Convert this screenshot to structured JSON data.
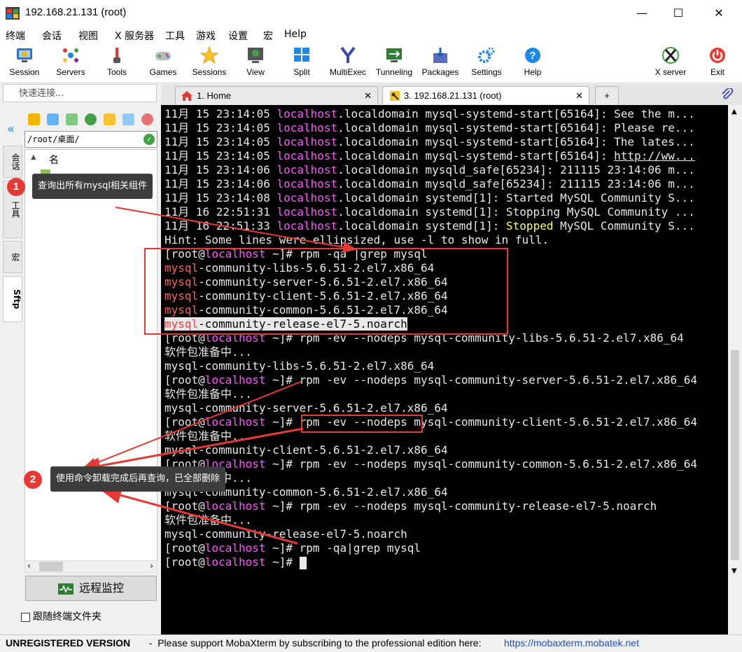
{
  "window": {
    "title": "192.168.21.131 (root)",
    "minimize": "—",
    "maximize": "☐",
    "close": "✕"
  },
  "menu": [
    "终端",
    "会话",
    "视图",
    "X 服务器",
    "工具",
    "游戏",
    "设置",
    "宏",
    "Help"
  ],
  "toolbar": [
    {
      "label": "Session",
      "icon": "session-icon"
    },
    {
      "label": "Servers",
      "icon": "servers-icon"
    },
    {
      "label": "Tools",
      "icon": "tools-icon"
    },
    {
      "label": "Games",
      "icon": "games-icon"
    },
    {
      "label": "Sessions",
      "icon": "sessions-star-icon"
    },
    {
      "label": "View",
      "icon": "view-icon"
    },
    {
      "label": "Split",
      "icon": "split-icon"
    },
    {
      "label": "MultiExec",
      "icon": "multiexec-icon"
    },
    {
      "label": "Tunneling",
      "icon": "tunneling-icon"
    },
    {
      "label": "Packages",
      "icon": "packages-icon"
    },
    {
      "label": "Settings",
      "icon": "settings-icon"
    },
    {
      "label": "Help",
      "icon": "help-icon"
    },
    {
      "label": "X server",
      "icon": "x-server-icon"
    },
    {
      "label": "Exit",
      "icon": "exit-icon"
    }
  ],
  "quick_connect_placeholder": "快速连接...",
  "tabs": [
    {
      "label": "1. Home"
    },
    {
      "label": "3. 192.168.21.131 (root)"
    }
  ],
  "side_tabs": [
    "会话",
    "工具",
    "宏",
    "Sftp"
  ],
  "sftp": {
    "path": "/root/桌面/",
    "column_name": "名",
    "monitor_button": "远程监控",
    "follow_label": "跟随终端文件夹"
  },
  "terminal_lines": [
    [
      {
        "t": "11月 15 23:14:05 "
      },
      {
        "t": "localhost",
        "c": "mag"
      },
      {
        "t": ".localdomain mysql-systemd-start[65164]: See the m..."
      }
    ],
    [
      {
        "t": "11月 15 23:14:05 "
      },
      {
        "t": "localhost",
        "c": "mag"
      },
      {
        "t": ".localdomain mysql-systemd-start[65164]: Please re..."
      }
    ],
    [
      {
        "t": "11月 15 23:14:05 "
      },
      {
        "t": "localhost",
        "c": "mag"
      },
      {
        "t": ".localdomain mysql-systemd-start[65164]: The lates..."
      }
    ],
    [
      {
        "t": "11月 15 23:14:05 "
      },
      {
        "t": "localhost",
        "c": "mag"
      },
      {
        "t": ".localdomain mysql-systemd-start[65164]: "
      },
      {
        "t": "http://ww...",
        "u": true
      }
    ],
    [
      {
        "t": "11月 15 23:14:06 "
      },
      {
        "t": "localhost",
        "c": "mag"
      },
      {
        "t": ".localdomain mysqld_safe[65234]: 211115 23:14:06 m..."
      }
    ],
    [
      {
        "t": "11月 15 23:14:06 "
      },
      {
        "t": "localhost",
        "c": "mag"
      },
      {
        "t": ".localdomain mysqld_safe[65234]: 211115 23:14:06 m..."
      }
    ],
    [
      {
        "t": "11月 15 23:14:08 "
      },
      {
        "t": "localhost",
        "c": "mag"
      },
      {
        "t": ".localdomain systemd[1]: Started MySQL Community S..."
      }
    ],
    [
      {
        "t": "11月 16 22:51:31 "
      },
      {
        "t": "localhost",
        "c": "mag"
      },
      {
        "t": ".localdomain systemd[1]: Stopping MySQL Community ..."
      }
    ],
    [
      {
        "t": "11月 16 22:51:33 "
      },
      {
        "t": "localhost",
        "c": "mag"
      },
      {
        "t": ".localdomain systemd[1]: "
      },
      {
        "t": "Stopped",
        "c": "yel"
      },
      {
        "t": " MySQL Community S..."
      }
    ],
    [
      {
        "t": "Hint: Some lines were ellipsized, use -l to show in full."
      }
    ],
    [
      {
        "t": "[root@"
      },
      {
        "t": "localhost",
        "c": "mag"
      },
      {
        "t": " ~]# rpm -qa |grep mysql"
      }
    ],
    [
      {
        "t": "mysql",
        "c": "red"
      },
      {
        "t": "-community-libs-5.6.51-2.el7.x86_64"
      }
    ],
    [
      {
        "t": "mysql",
        "c": "red"
      },
      {
        "t": "-community-server-5.6.51-2.el7.x86_64"
      }
    ],
    [
      {
        "t": "mysql",
        "c": "red"
      },
      {
        "t": "-community-client-5.6.51-2.el7.x86_64"
      }
    ],
    [
      {
        "t": "mysql",
        "c": "red"
      },
      {
        "t": "-community-common-5.6.51-2.el7.x86_64"
      }
    ],
    [
      {
        "t": "mysql",
        "c": "hlred"
      },
      {
        "t": "-community-release-el7-5.noarch",
        "c": "hl"
      }
    ],
    [
      {
        "t": "[root@"
      },
      {
        "t": "localhost",
        "c": "mag"
      },
      {
        "t": " ~]# rpm -ev --nodeps mysql-community-libs-5.6.51-2.el7.x86_64"
      }
    ],
    [
      {
        "t": "软件包准备中..."
      }
    ],
    [
      {
        "t": "mysql-community-libs-5.6.51-2.el7.x86_64"
      }
    ],
    [
      {
        "t": "[root@"
      },
      {
        "t": "localhost",
        "c": "mag"
      },
      {
        "t": " ~]# rpm -ev --nodeps mysql-community-server-5.6.51-2.el7.x86_64"
      }
    ],
    [
      {
        "t": "软件包准备中..."
      }
    ],
    [
      {
        "t": "mysql-community-server-5.6.51-2.el7.x86_64"
      }
    ],
    [
      {
        "t": "[root@"
      },
      {
        "t": "localhost",
        "c": "mag"
      },
      {
        "t": " ~]# rpm -ev --nodeps mysql-community-client-5.6.51-2.el7.x86_64"
      }
    ],
    [
      {
        "t": "软件包准备中..."
      }
    ],
    [
      {
        "t": "mysql-community-client-5.6.51-2.el7.x86_64"
      }
    ],
    [
      {
        "t": "[root@"
      },
      {
        "t": "localhost",
        "c": "mag"
      },
      {
        "t": " ~]# rpm -ev --nodeps mysql-community-common-5.6.51-2.el7.x86_64"
      }
    ],
    [
      {
        "t": "软件包准备中..."
      }
    ],
    [
      {
        "t": "mysql-community-common-5.6.51-2.el7.x86_64"
      }
    ],
    [
      {
        "t": "[root@"
      },
      {
        "t": "localhost",
        "c": "mag"
      },
      {
        "t": " ~]# rpm -ev --nodeps mysql-community-release-el7-5.noarch"
      }
    ],
    [
      {
        "t": "软件包准备中..."
      }
    ],
    [
      {
        "t": "mysql-community-release-el7-5.noarch"
      }
    ],
    [
      {
        "t": "[root@"
      },
      {
        "t": "localhost",
        "c": "mag"
      },
      {
        "t": " ~]# rpm -qa|grep mysql"
      }
    ],
    [
      {
        "t": "[root@"
      },
      {
        "t": "localhost",
        "c": "mag"
      },
      {
        "t": " ~]# "
      },
      {
        "cursor": true
      }
    ]
  ],
  "annotations": {
    "callout1": {
      "number": "1",
      "text": "查询出所有mysql相关组件"
    },
    "callout2": {
      "number": "2",
      "text": "使用命令卸载完成后再查询，已全部删除"
    }
  },
  "status": {
    "unregistered": "UNREGISTERED VERSION",
    "message": "  -  Please support MobaXterm by subscribing to the professional edition here:",
    "link": "https://mobaxterm.mobatek.net"
  },
  "colors": {
    "prompt_host": "#ff55ff",
    "highlight_box": "#e53935",
    "callout_bg": "#3c3c3c"
  }
}
